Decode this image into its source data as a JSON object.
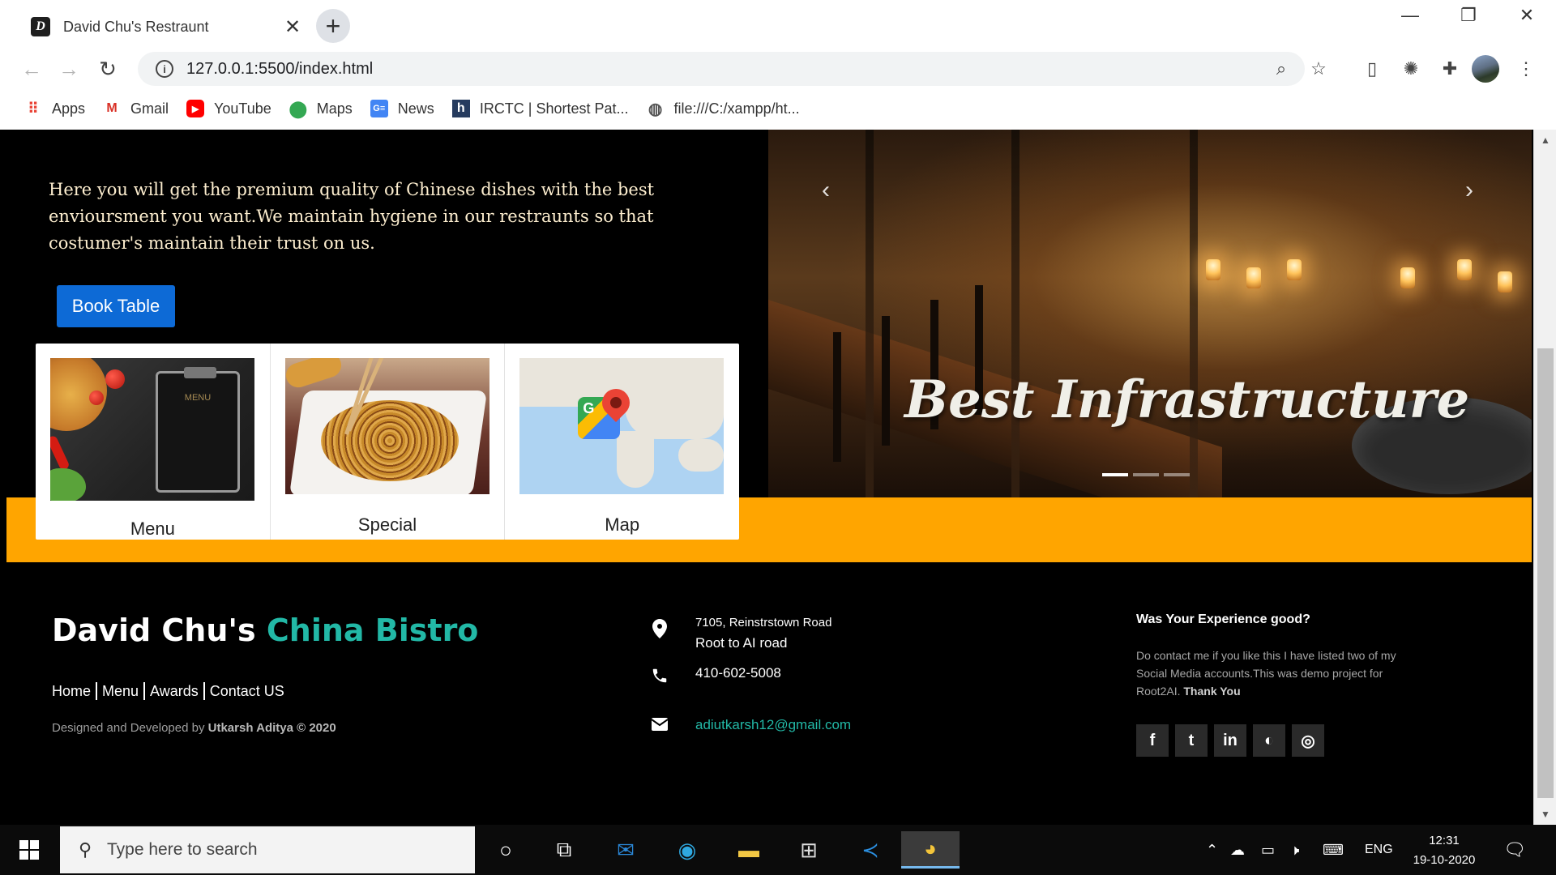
{
  "browser": {
    "tab_title": "David Chu's Restraunt",
    "tab_favicon_letter": "D",
    "tab_close": "✕",
    "new_tab": "+",
    "url": "127.0.0.1:5500/index.html",
    "window_controls": {
      "minimize": "—",
      "restore": "❐",
      "close": "✕"
    },
    "bookmarks": [
      {
        "label": "Apps",
        "icon": "apps-grid-icon"
      },
      {
        "label": "Gmail",
        "icon": "gmail-icon"
      },
      {
        "label": "YouTube",
        "icon": "youtube-icon"
      },
      {
        "label": "Maps",
        "icon": "maps-icon"
      },
      {
        "label": "News",
        "icon": "news-icon"
      },
      {
        "label": "IRCTC | Shortest Pat...",
        "icon": "h-icon"
      },
      {
        "label": "file:///C:/xampp/ht...",
        "icon": "globe-icon"
      }
    ]
  },
  "hero": {
    "description": "Here you will get the premium quality of Chinese dishes with the best envioursment you want.We maintain hygiene in our restraunts so that costumer's maintain their trust on us.",
    "book_button": "Book Table",
    "carousel_caption": "Best Infrastructure",
    "carousel_prev": "‹",
    "carousel_next": "›",
    "carousel_active_index": 0,
    "carousel_count": 3
  },
  "cards": [
    {
      "title": "Menu",
      "menu_board_text": "MENU"
    },
    {
      "title": "Special"
    },
    {
      "title": "Map",
      "map_logo_letter": "G"
    }
  ],
  "footer": {
    "brand_main": "David Chu's",
    "brand_accent": "China Bistro",
    "links": [
      "Home",
      "Menu",
      "Awards",
      "Contact US"
    ],
    "credits_prefix": "Designed and Developed by",
    "credits_author": "Utkarsh Aditya © 2020",
    "address_line1": "7105, Reinstrstown Road",
    "address_line2": "Root to AI road",
    "phone": "410-602-5008",
    "email": "adiutkarsh12@gmail.com",
    "about_title": "Was Your Experience good?",
    "about_text": "Do contact me if you like this I have listed two of my Social Media accounts.This was demo project for Root2AI.",
    "about_thanks": "Thank You",
    "socials": [
      "facebook-icon",
      "twitter-icon",
      "linkedin-icon",
      "github-icon",
      "instagram-icon"
    ],
    "social_glyphs": [
      "f",
      "t",
      "in",
      "◐",
      "◎"
    ]
  },
  "taskbar": {
    "search_placeholder": "Type here to search",
    "language": "ENG",
    "time": "12:31",
    "date": "19-10-2020"
  },
  "colors": {
    "accent_teal": "#22b8a6",
    "band_orange": "#ffa500",
    "button_blue": "#0d6ad6",
    "hero_text": "#fdeecf"
  }
}
